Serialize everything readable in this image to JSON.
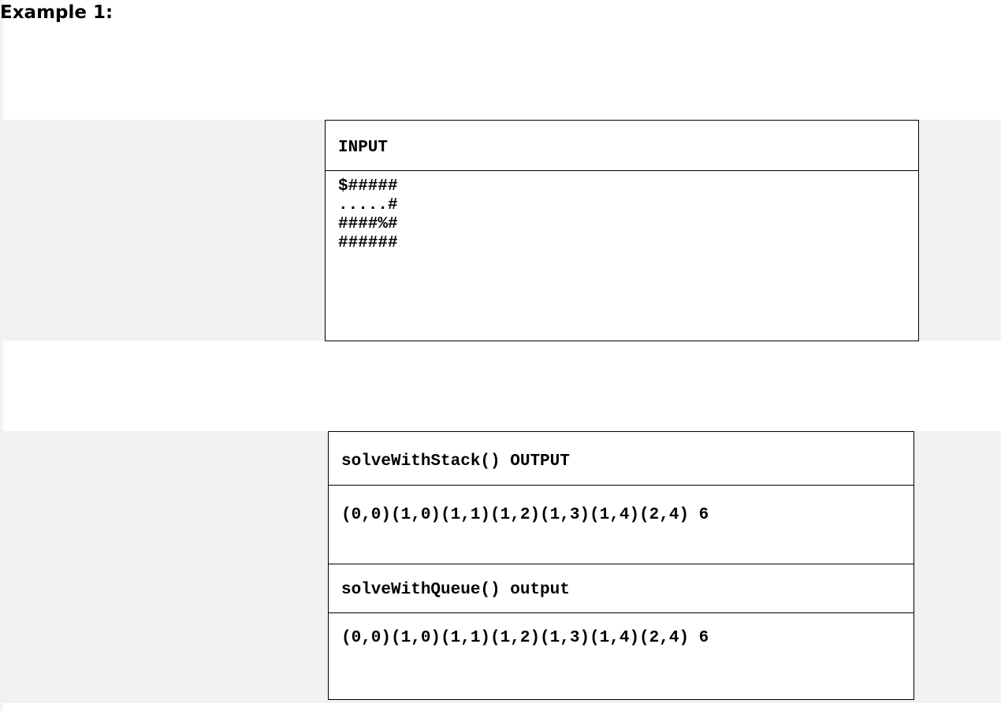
{
  "heading": "Example 1:",
  "input_table": {
    "header": "INPUT",
    "grid_lines": [
      "$#####",
      ".....#",
      "####%#",
      "######"
    ]
  },
  "output_table": {
    "stack_header": "solveWithStack() OUTPUT",
    "stack_result": "(0,0)(1,0)(1,1)(1,2)(1,3)(1,4)(2,4) 6",
    "queue_header": "solveWithQueue() output",
    "queue_result": "(0,0)(1,0)(1,1)(1,2)(1,3)(1,4)(2,4) 6"
  }
}
